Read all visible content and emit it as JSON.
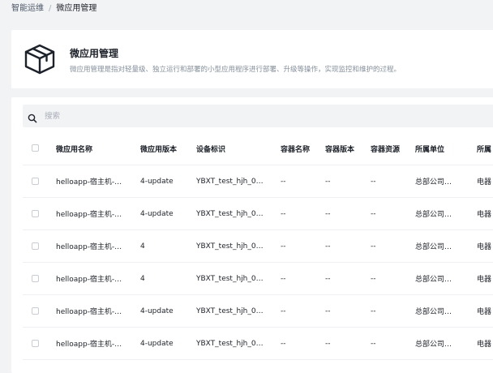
{
  "breadcrumb": {
    "items": [
      "智能运维",
      "微应用管理"
    ],
    "separator": "/"
  },
  "header": {
    "title": "微应用管理",
    "description": "微应用管理是指对轻量级、独立运行和部署的小型应用程序进行部署、升级等操作，实现监控和维护的过程。",
    "icon": "cube-icon"
  },
  "search": {
    "placeholder": "搜索",
    "value": "",
    "icon": "search-icon"
  },
  "table": {
    "columns": [
      "微应用名称",
      "微应用版本",
      "设备标识",
      "容器名称",
      "容器版本",
      "容器资源",
      "所属单位",
      "所属"
    ],
    "rows": [
      [
        "helloapp-宿主机-…",
        "4-update",
        "YBXT_test_hjh_0…",
        "--",
        "--",
        "--",
        "总部公司…",
        "电器"
      ],
      [
        "helloapp-宿主机-…",
        "4-update",
        "YBXT_test_hjh_0…",
        "--",
        "--",
        "--",
        "总部公司…",
        "电器"
      ],
      [
        "helloapp-宿主机-…",
        "4",
        "YBXT_test_hjh_0…",
        "--",
        "--",
        "--",
        "总部公司…",
        "电器"
      ],
      [
        "helloapp-宿主机-…",
        "4",
        "YBXT_test_hjh_0…",
        "--",
        "--",
        "--",
        "总部公司…",
        "电器"
      ],
      [
        "helloapp-宿主机-…",
        "4-update",
        "YBXT_test_hjh_0…",
        "--",
        "--",
        "--",
        "总部公司…",
        "电器"
      ],
      [
        "helloapp-宿主机-…",
        "4-update",
        "YBXT_test_hjh_0…",
        "--",
        "--",
        "--",
        "总部公司…",
        "电器"
      ]
    ]
  },
  "colors": {
    "page_bg": "#f2f3f5",
    "card_bg": "#ffffff",
    "text_primary": "#1d2129",
    "text_secondary": "#86909c"
  }
}
